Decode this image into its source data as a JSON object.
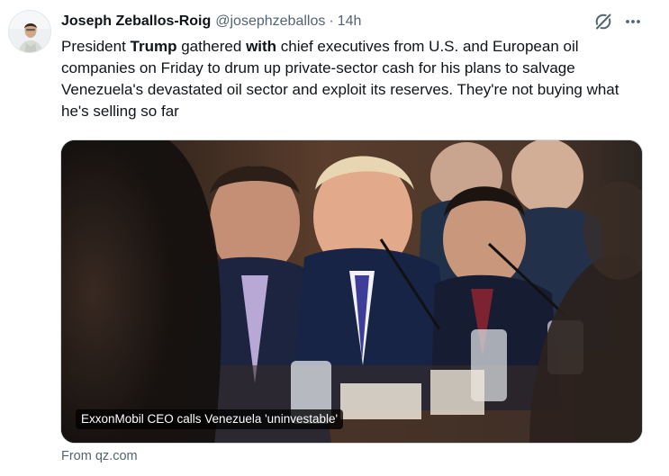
{
  "tweet": {
    "author_name": "Joseph Zeballos-Roig",
    "handle": "@josephzeballos",
    "separator": "·",
    "time": "14h",
    "text": {
      "part1": "President ",
      "bold1": "Trump",
      "part2": " gathered ",
      "bold2": "with",
      "part3": " chief executives from U.S. and European oil companies on Friday to drum up private-sector cash for his plans to salvage Venezuela's devastated oil sector and exploit its reserves. They're not buying what he's selling so far"
    },
    "card": {
      "caption": "ExxonMobil CEO calls Venezuela 'uninvestable'",
      "source": "From qz.com"
    }
  },
  "icons": {
    "grok": "grok-icon",
    "more": "more-icon"
  },
  "colors": {
    "text_primary": "#0f1419",
    "text_secondary": "#536471",
    "border": "#cfd9de"
  }
}
